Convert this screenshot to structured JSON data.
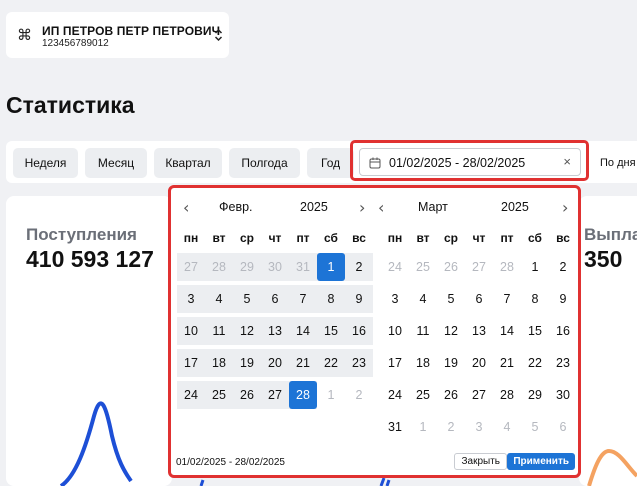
{
  "org": {
    "icon": "command-icon",
    "name": "ИП ПЕТРОВ ПЕТР ПЕТРОВИЧ",
    "inn": "123456789012"
  },
  "page_title": "Статистика",
  "periods": [
    "Неделя",
    "Месяц",
    "Квартал",
    "Полгода",
    "Год"
  ],
  "date_range": {
    "value": "01/02/2025 - 28/02/2025"
  },
  "group_by": {
    "value": "По дня"
  },
  "cards": [
    {
      "label": "Поступления",
      "amount": "410 593 127"
    },
    {
      "label": "Выпла",
      "amount": "350"
    }
  ],
  "picker": {
    "weekdays": [
      "пн",
      "вт",
      "ср",
      "чт",
      "пт",
      "сб",
      "вс"
    ],
    "left": {
      "month": "Февр.",
      "year": "2025",
      "weeks": [
        [
          "27",
          "28",
          "29",
          "30",
          "31",
          "1",
          "2"
        ],
        [
          "3",
          "4",
          "5",
          "6",
          "7",
          "8",
          "9"
        ],
        [
          "10",
          "11",
          "12",
          "13",
          "14",
          "15",
          "16"
        ],
        [
          "17",
          "18",
          "19",
          "20",
          "21",
          "22",
          "23"
        ],
        [
          "24",
          "25",
          "26",
          "27",
          "28",
          "1",
          "2"
        ]
      ]
    },
    "right": {
      "month": "Март",
      "year": "2025",
      "weeks": [
        [
          "24",
          "25",
          "26",
          "27",
          "28",
          "1",
          "2"
        ],
        [
          "3",
          "4",
          "5",
          "6",
          "7",
          "8",
          "9"
        ],
        [
          "10",
          "11",
          "12",
          "13",
          "14",
          "15",
          "16"
        ],
        [
          "17",
          "18",
          "19",
          "20",
          "21",
          "22",
          "23"
        ],
        [
          "24",
          "25",
          "26",
          "27",
          "28",
          "29",
          "30"
        ],
        [
          "31",
          "1",
          "2",
          "3",
          "4",
          "5",
          "6"
        ]
      ]
    },
    "range_text": "01/02/2025 - 28/02/2025",
    "close_label": "Закрыть",
    "apply_label": "Применить"
  },
  "colors": {
    "accent": "#1d74d6",
    "highlight": "#e03131",
    "chart_blue": "#1d4fd6",
    "chart_orange": "#f4a261"
  }
}
